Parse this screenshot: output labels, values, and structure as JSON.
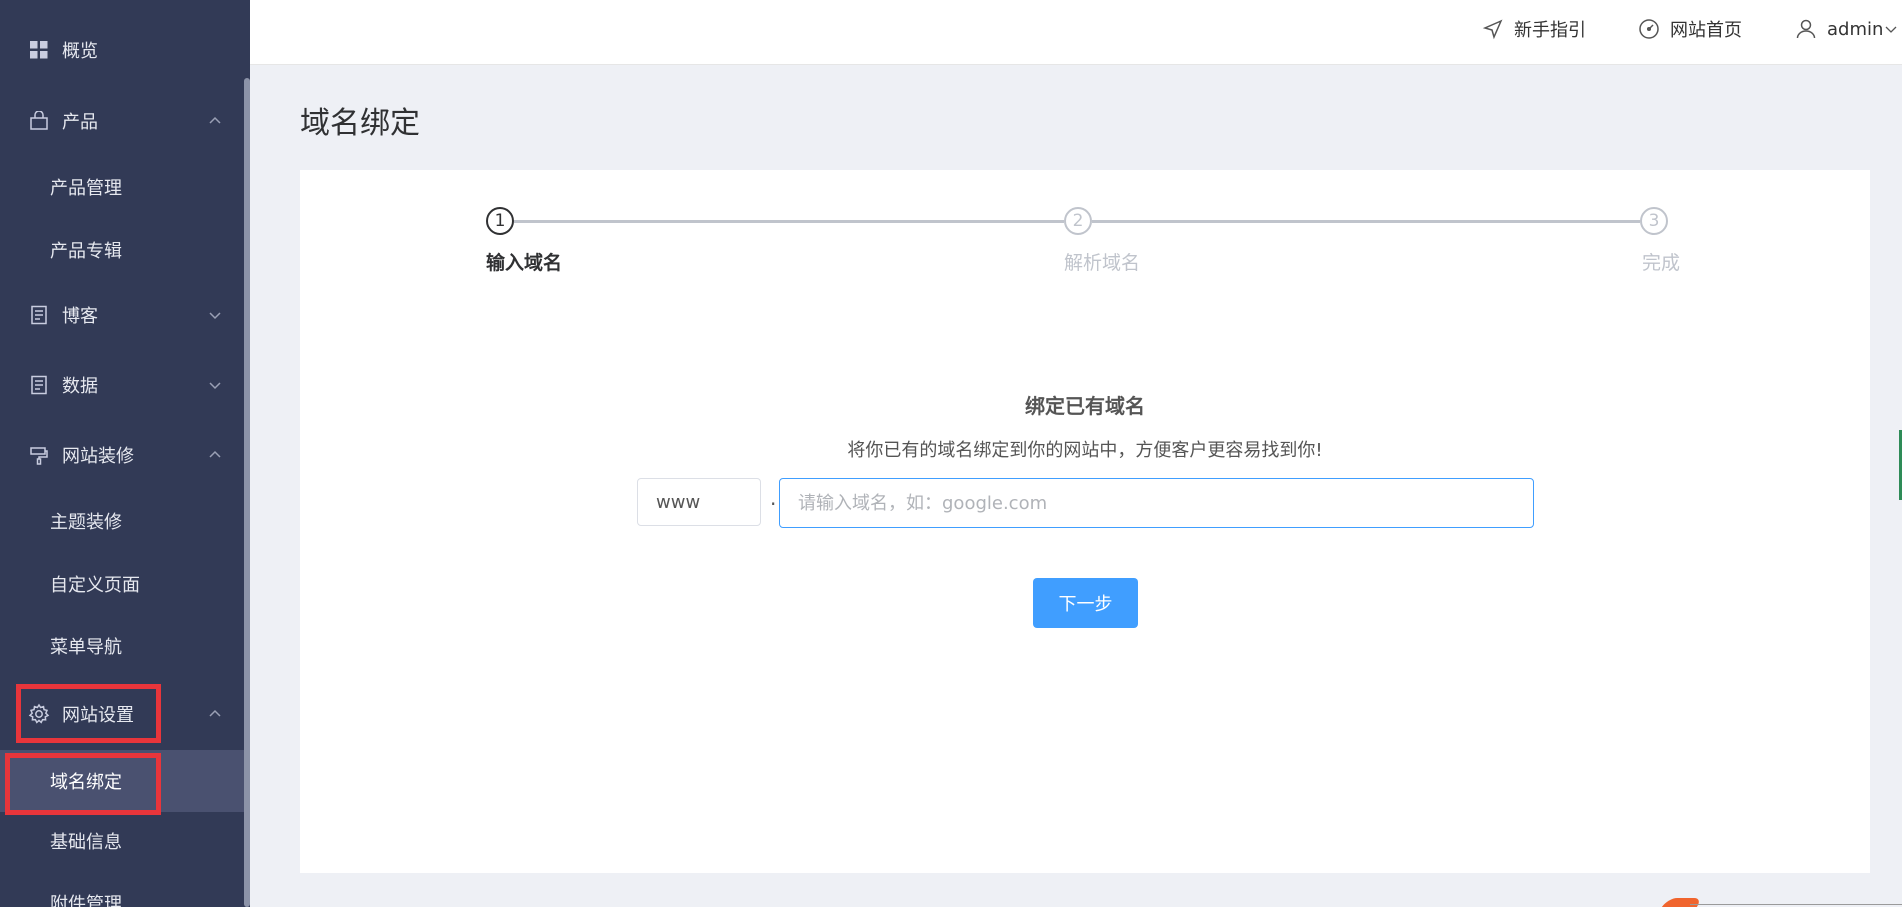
{
  "sidebar": {
    "items": [
      {
        "label": "概览"
      },
      {
        "label": "产品"
      },
      {
        "label": "产品管理"
      },
      {
        "label": "产品专辑"
      },
      {
        "label": "博客"
      },
      {
        "label": "数据"
      },
      {
        "label": "网站装修"
      },
      {
        "label": "主题装修"
      },
      {
        "label": "自定义页面"
      },
      {
        "label": "菜单导航"
      },
      {
        "label": "网站设置"
      },
      {
        "label": "域名绑定"
      },
      {
        "label": "基础信息"
      },
      {
        "label": "附件管理"
      }
    ]
  },
  "header": {
    "guide_label": "新手指引",
    "home_label": "网站首页",
    "user_label": "admin"
  },
  "page": {
    "title": "域名绑定"
  },
  "steps": [
    {
      "number": "1",
      "label": "输入域名"
    },
    {
      "number": "2",
      "label": "解析域名"
    },
    {
      "number": "3",
      "label": "完成"
    }
  ],
  "bind": {
    "title": "绑定已有域名",
    "description": "将你已有的域名绑定到你的网站中，方便客户更容易找到你!",
    "prefix": "www",
    "separator": ".",
    "placeholder": "请输入域名，如：google.com",
    "value": "",
    "next_label": "下一步"
  },
  "colors": {
    "sidebar_bg": "#323a56",
    "active_bg": "#4a5170",
    "accent": "#409eff",
    "highlight": "#e8353b"
  }
}
